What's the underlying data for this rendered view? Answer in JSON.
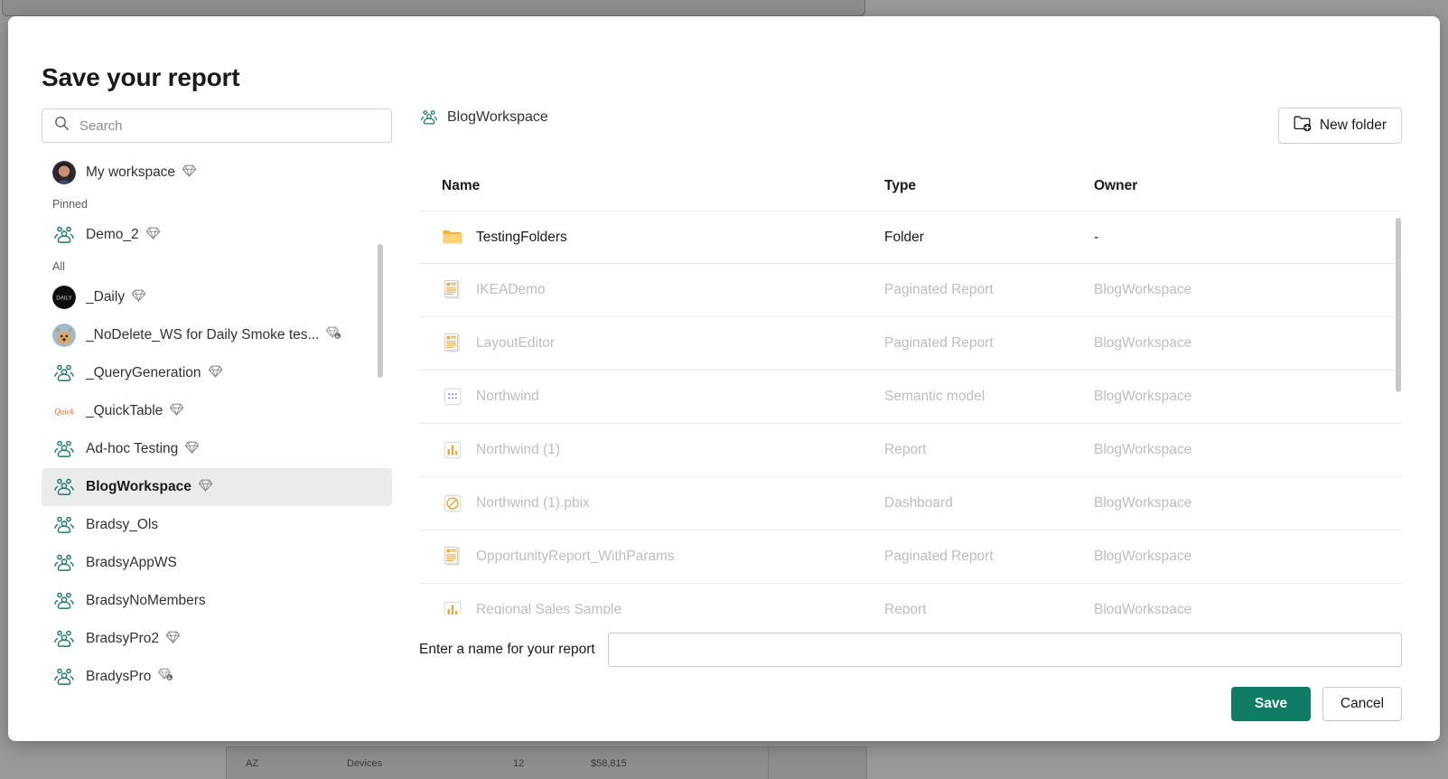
{
  "dialog": {
    "title": "Save your report"
  },
  "search": {
    "placeholder": "Search",
    "value": "",
    "icon": "search-icon"
  },
  "sidebar": {
    "my_workspace": {
      "label": "My workspace",
      "badge": "diamond-icon",
      "icon": "avatar-photo"
    },
    "groups": [
      {
        "label": "Pinned",
        "items": [
          {
            "label": "Demo_2",
            "icon": "workspace-group-icon",
            "badge": "diamond-icon",
            "selected": false
          }
        ]
      },
      {
        "label": "All",
        "items": [
          {
            "label": "_Daily",
            "icon": "avatar-dark",
            "badge": "diamond-icon",
            "selected": false
          },
          {
            "label": "_NoDelete_WS for Daily Smoke tes...",
            "icon": "avatar-dog",
            "badge": "diamond-trial-icon",
            "selected": false
          },
          {
            "label": "_QueryGeneration",
            "icon": "workspace-group-icon",
            "badge": "diamond-icon",
            "selected": false
          },
          {
            "label": "_QuickTable",
            "icon": "avatar-quick",
            "badge": "diamond-icon",
            "selected": false
          },
          {
            "label": "Ad-hoc Testing",
            "icon": "workspace-group-icon",
            "badge": "diamond-icon",
            "selected": false
          },
          {
            "label": "BlogWorkspace",
            "icon": "workspace-group-icon",
            "badge": "diamond-icon",
            "selected": true
          },
          {
            "label": "Bradsy_Ols",
            "icon": "workspace-group-icon",
            "badge": "",
            "selected": false
          },
          {
            "label": "BradsyAppWS",
            "icon": "workspace-group-icon",
            "badge": "",
            "selected": false
          },
          {
            "label": "BradsyNoMembers",
            "icon": "workspace-group-icon",
            "badge": "",
            "selected": false
          },
          {
            "label": "BradsyPro2",
            "icon": "workspace-group-icon",
            "badge": "diamond-icon",
            "selected": false
          },
          {
            "label": "BradysPro",
            "icon": "workspace-group-icon",
            "badge": "diamond-trial-icon",
            "selected": false
          }
        ]
      }
    ]
  },
  "content": {
    "breadcrumb": "BlogWorkspace",
    "breadcrumb_icon": "workspace-group-icon",
    "new_folder_label": "New folder",
    "new_folder_icon": "new-folder-icon",
    "columns": {
      "name": "Name",
      "type": "Type",
      "owner": "Owner"
    },
    "rows": [
      {
        "name": "TestingFolders",
        "type": "Folder",
        "owner": "-",
        "icon": "folder-icon",
        "enabled": true
      },
      {
        "name": "IKEADemo",
        "type": "Paginated Report",
        "owner": "BlogWorkspace",
        "icon": "paginated-report-icon",
        "enabled": false
      },
      {
        "name": "LayoutEditor",
        "type": "Paginated Report",
        "owner": "BlogWorkspace",
        "icon": "paginated-report-icon",
        "enabled": false
      },
      {
        "name": "Northwind",
        "type": "Semantic model",
        "owner": "BlogWorkspace",
        "icon": "semantic-model-icon",
        "enabled": false
      },
      {
        "name": "Northwind (1)",
        "type": "Report",
        "owner": "BlogWorkspace",
        "icon": "report-icon",
        "enabled": false
      },
      {
        "name": "Northwind (1).pbix",
        "type": "Dashboard",
        "owner": "BlogWorkspace",
        "icon": "dashboard-icon",
        "enabled": false
      },
      {
        "name": "OpportunityReport_WithParams",
        "type": "Paginated Report",
        "owner": "BlogWorkspace",
        "icon": "paginated-report-icon",
        "enabled": false
      },
      {
        "name": "Regional Sales Sample",
        "type": "Report",
        "owner": "BlogWorkspace",
        "icon": "report-icon",
        "enabled": false
      }
    ]
  },
  "footer": {
    "name_label": "Enter a name for your report",
    "name_value": "",
    "name_placeholder": "",
    "save_label": "Save",
    "cancel_label": "Cancel"
  },
  "background": {
    "row": {
      "state": "AZ",
      "category": "Devices",
      "count": "12",
      "amount": "$58,815"
    }
  },
  "colors": {
    "accent_green": "#107c66",
    "workspace_icon": "#1b7a6a",
    "folder_yellow": "#f5c242",
    "selected_row_bg": "#ebebeb"
  }
}
